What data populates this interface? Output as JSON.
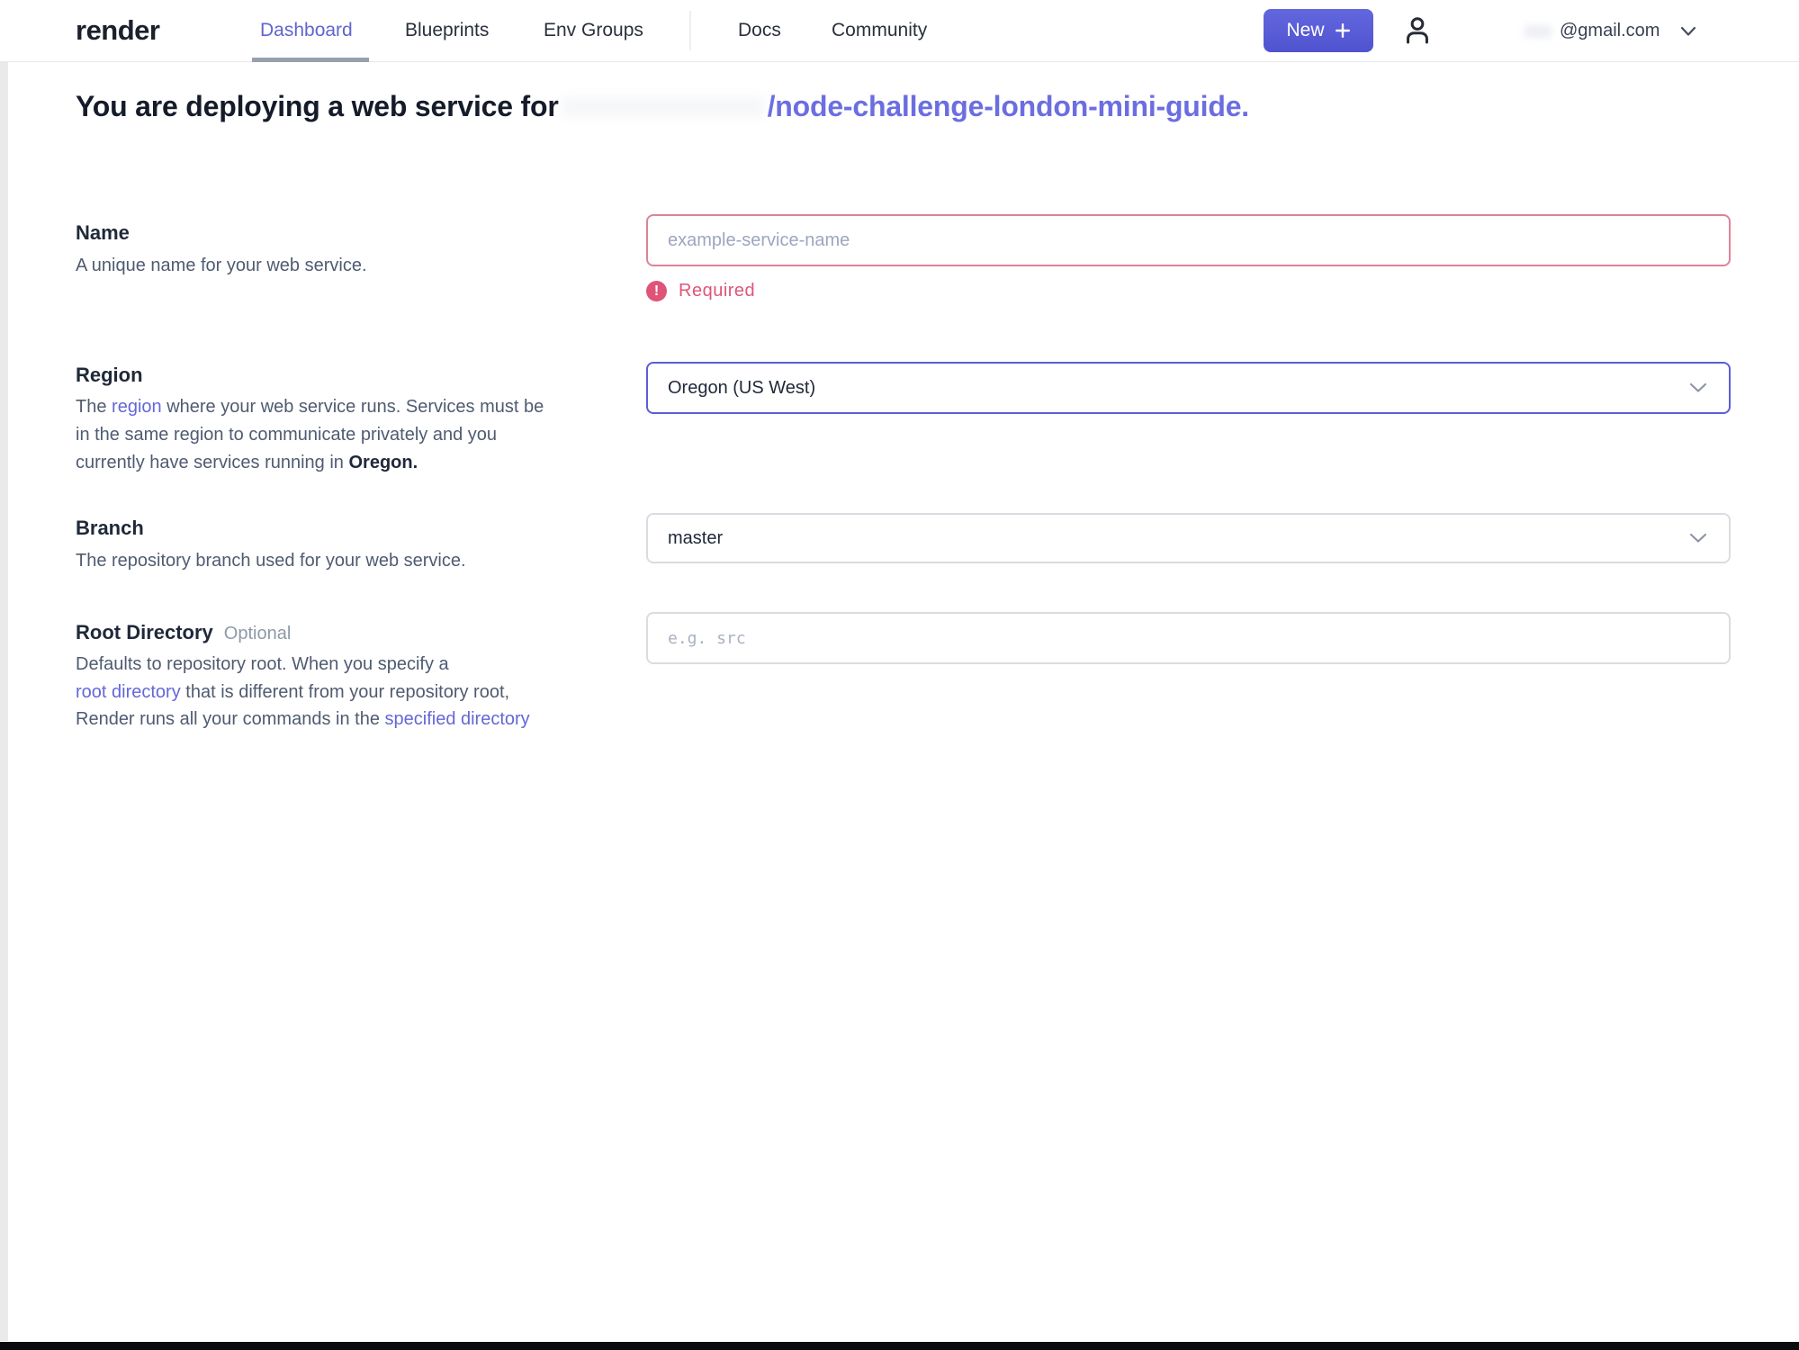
{
  "nav": {
    "logo": "render",
    "dashboard": "Dashboard",
    "blueprints": "Blueprints",
    "env_groups": "Env Groups",
    "docs": "Docs",
    "community": "Community",
    "new_button": "New",
    "account_email": "@gmail.com"
  },
  "heading": {
    "prefix": "You are deploying a web service for",
    "repo": "/node-challenge-london-mini-guide."
  },
  "form": {
    "name": {
      "label": "Name",
      "description": "A unique name for your web service.",
      "placeholder": "example-service-name",
      "error": "Required"
    },
    "region": {
      "label": "Region",
      "desc_1": "The ",
      "desc_link": "region",
      "desc_2": " where your web service runs. Services must be",
      "desc_3": "in the same region to communicate privately and you",
      "desc_4": "currently have services running in ",
      "desc_bold": "Oregon.",
      "value": "Oregon (US West)"
    },
    "branch": {
      "label": "Branch",
      "description": "The repository branch used for your web service.",
      "value": "master"
    },
    "root_directory": {
      "label": "Root Directory",
      "optional_tag": "Optional",
      "desc_1": "Defaults to repository root. When you specify a",
      "desc_link1": "root directory",
      "desc_2": " that is different from your repository root,",
      "desc_3": "Render runs all your commands in the ",
      "desc_link2": "specified directory",
      "placeholder": "e.g. src"
    }
  },
  "colors": {
    "accent_purple": "#5a5ed8",
    "heading_link_purple": "#6b6ee1",
    "error_pink": "#df5577",
    "text_link_purple": "#6467d6"
  }
}
